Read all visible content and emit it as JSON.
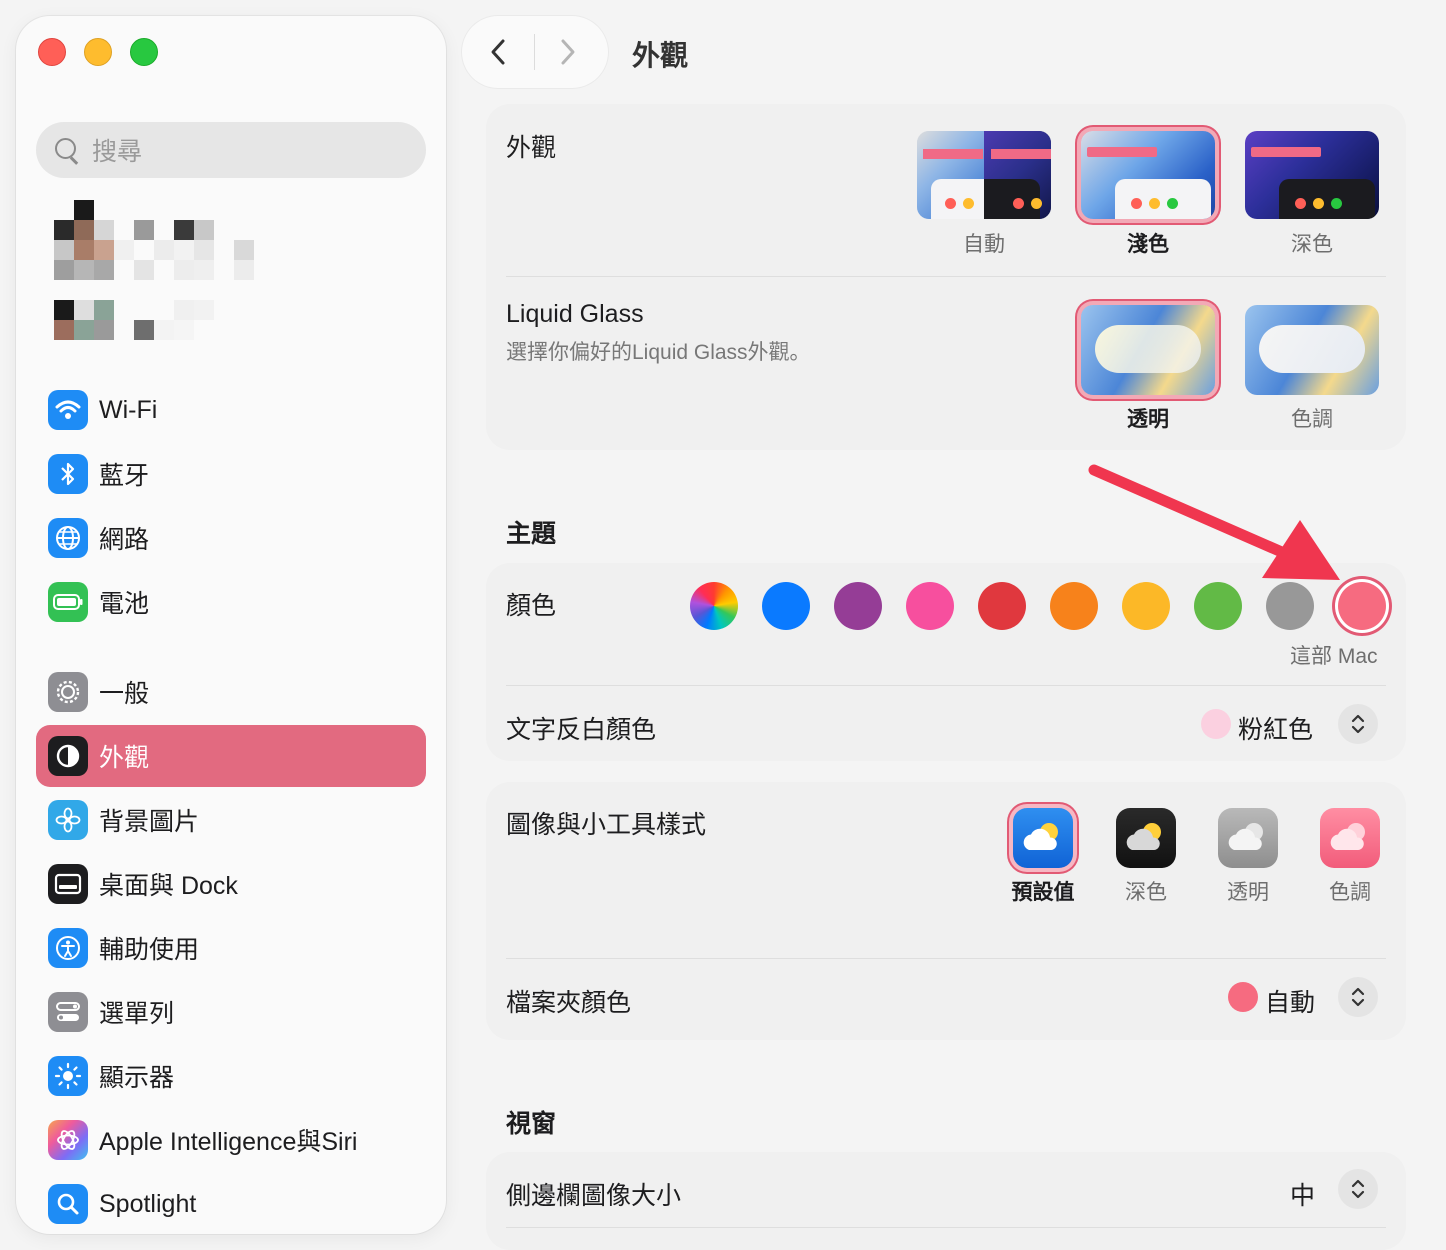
{
  "window": {
    "title": "外觀"
  },
  "sidebar": {
    "search_placeholder": "搜尋",
    "group1": [
      {
        "label": "Wi-Fi",
        "icon": "wifi-icon",
        "color": "#1e8cf5"
      },
      {
        "label": "藍牙",
        "icon": "bluetooth-icon",
        "color": "#1e8cf5"
      },
      {
        "label": "網路",
        "icon": "globe-icon",
        "color": "#1e8cf5"
      },
      {
        "label": "電池",
        "icon": "battery-icon",
        "color": "#33c154"
      }
    ],
    "group2": [
      {
        "label": "一般",
        "icon": "gear-icon",
        "color": "#8e8e93"
      },
      {
        "label": "外觀",
        "icon": "appearance-icon",
        "color": "#1d1d1f",
        "active": true
      },
      {
        "label": "背景圖片",
        "icon": "flower-icon",
        "color": "#31a8e8"
      },
      {
        "label": "桌面與 Dock",
        "icon": "dock-icon",
        "color": "#1d1d1f"
      },
      {
        "label": "輔助使用",
        "icon": "accessibility-icon",
        "color": "#1e8cf5"
      },
      {
        "label": "選單列",
        "icon": "menubar-icon",
        "color": "#8e8e93"
      },
      {
        "label": "顯示器",
        "icon": "sun-icon",
        "color": "#1e8cf5"
      },
      {
        "label": "Apple Intelligence與Siri",
        "icon": "apple-intelligence-icon",
        "color": "#f07ab0"
      },
      {
        "label": "Spotlight",
        "icon": "spotlight-icon",
        "color": "#1e8cf5"
      }
    ]
  },
  "appearance": {
    "label": "外觀",
    "options": [
      {
        "label": "自動",
        "selected": false
      },
      {
        "label": "淺色",
        "selected": true
      },
      {
        "label": "深色",
        "selected": false
      }
    ]
  },
  "liquid_glass": {
    "label": "Liquid Glass",
    "subtitle": "選擇你偏好的Liquid Glass外觀。",
    "options": [
      {
        "label": "透明",
        "selected": true
      },
      {
        "label": "色調",
        "selected": false
      }
    ]
  },
  "theme": {
    "section_title": "主題",
    "color_label": "顏色",
    "colors": [
      {
        "name": "multicolor",
        "hex": "conic"
      },
      {
        "name": "blue",
        "hex": "#0a7aff"
      },
      {
        "name": "purple",
        "hex": "#953d96"
      },
      {
        "name": "pink",
        "hex": "#f74f9e"
      },
      {
        "name": "red",
        "hex": "#e0383e"
      },
      {
        "name": "orange",
        "hex": "#f7821b"
      },
      {
        "name": "yellow",
        "hex": "#fcb827"
      },
      {
        "name": "green",
        "hex": "#62ba46"
      },
      {
        "name": "graphite",
        "hex": "#989898"
      },
      {
        "name": "this-mac",
        "hex": "#f66b80",
        "selected": true
      }
    ],
    "selected_caption": "這部 Mac",
    "highlight_label": "文字反白顏色",
    "highlight_value": "粉紅色",
    "highlight_dot": "#fbd0e0"
  },
  "icon_widget": {
    "label": "圖像與小工具樣式",
    "options": [
      {
        "label": "預設值",
        "selected": true
      },
      {
        "label": "深色",
        "selected": false
      },
      {
        "label": "透明",
        "selected": false
      },
      {
        "label": "色調",
        "selected": false
      }
    ],
    "folder_label": "檔案夾顏色",
    "folder_value": "自動",
    "folder_dot": "#f66b80"
  },
  "windows": {
    "section_title": "視窗",
    "sidebar_icon_size_label": "側邊欄圖像大小",
    "sidebar_icon_size_value": "中"
  },
  "accent": "#e26a80",
  "annotation_arrow_color": "#f0364f"
}
